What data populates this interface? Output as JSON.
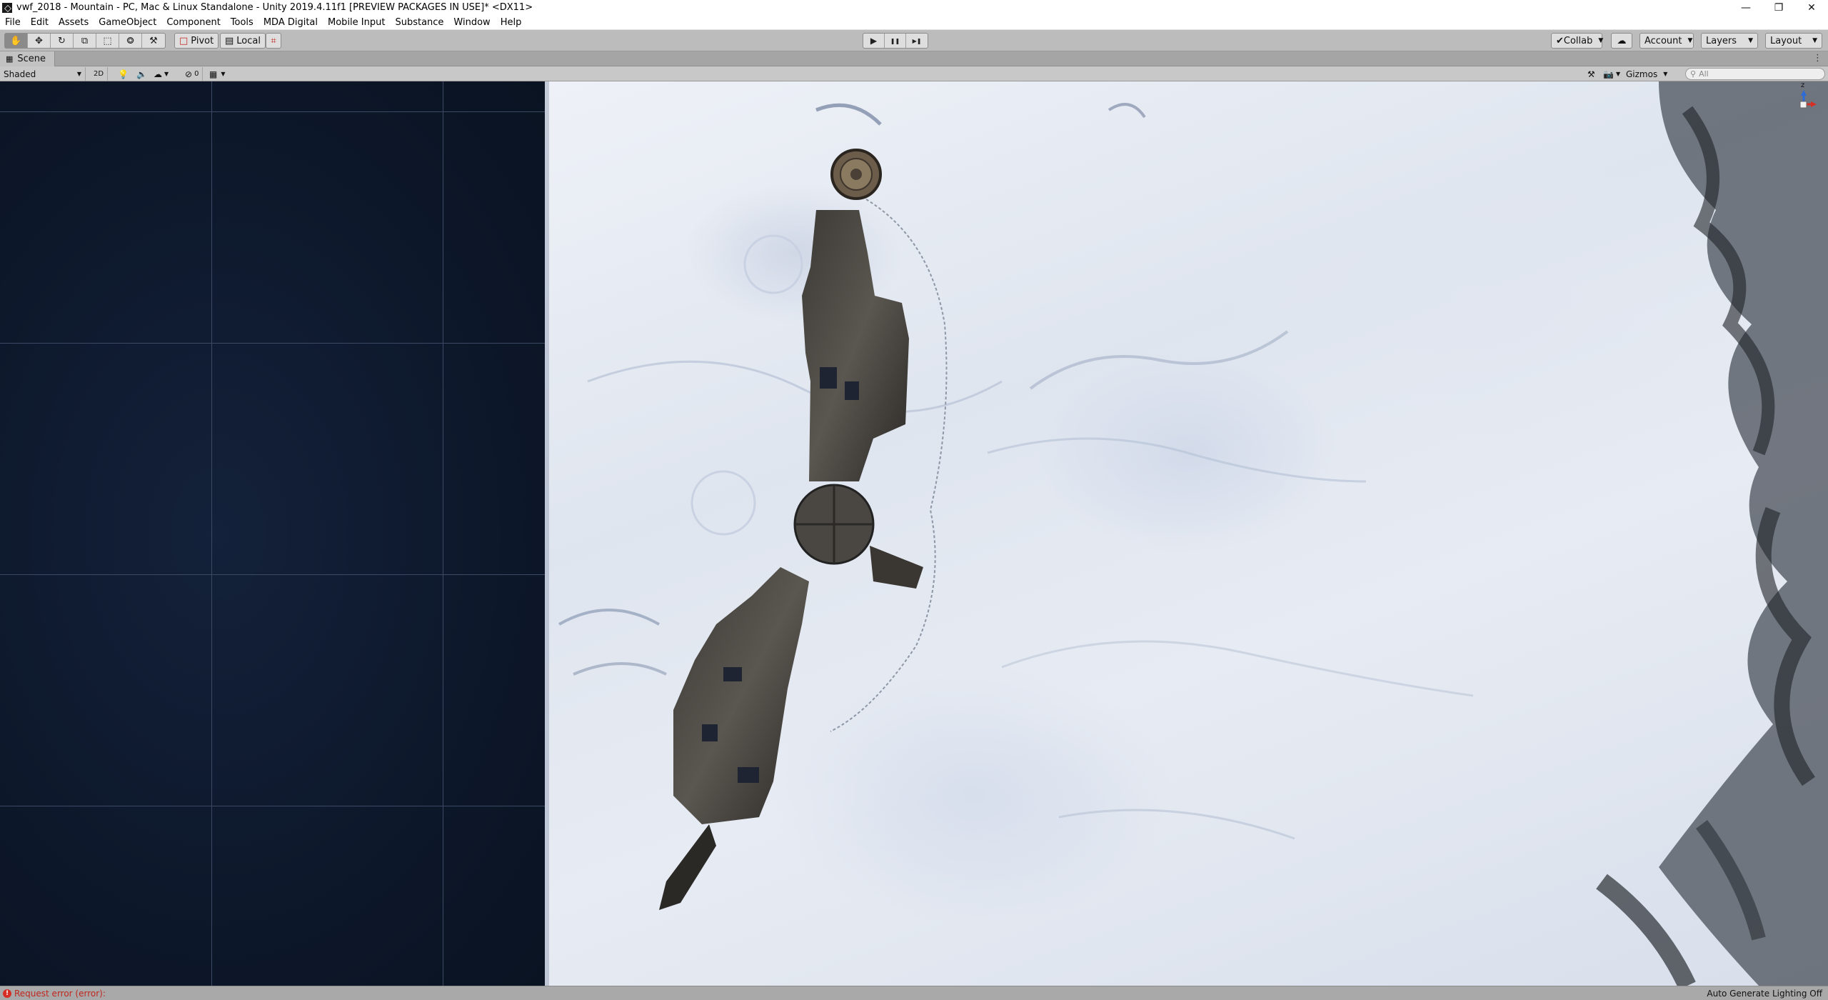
{
  "window": {
    "title": "vwf_2018 - Mountain - PC, Mac & Linux Standalone - Unity 2019.4.11f1 [PREVIEW PACKAGES IN USE]* <DX11>",
    "minimize_glyph": "—",
    "maximize_glyph": "❐",
    "close_glyph": "✕"
  },
  "menu": {
    "items": [
      "File",
      "Edit",
      "Assets",
      "GameObject",
      "Component",
      "Tools",
      "MDA Digital",
      "Mobile Input",
      "Substance",
      "Window",
      "Help"
    ]
  },
  "toolbar": {
    "tools": [
      {
        "icon": "hand-icon",
        "glyph": "✋"
      },
      {
        "icon": "move-icon",
        "glyph": "✥"
      },
      {
        "icon": "rotate-icon",
        "glyph": "↻"
      },
      {
        "icon": "scale-icon",
        "glyph": "⧉"
      },
      {
        "icon": "rect-icon",
        "glyph": "⬚"
      },
      {
        "icon": "transform-icon",
        "glyph": "⭗"
      },
      {
        "icon": "custom-tool-icon",
        "glyph": "⚒"
      }
    ],
    "pivot_label": "Pivot",
    "local_label": "Local",
    "grid_snap_glyph": "⌗",
    "play_glyph": "▶",
    "pause_glyph": "❚❚",
    "step_glyph": "▶❚",
    "collab_label": "Collab",
    "cloud_glyph": "☁",
    "account_label": "Account",
    "layers_label": "Layers",
    "layout_label": "Layout"
  },
  "scene_tab": {
    "label": "Scene",
    "menu_glyph": "⋮"
  },
  "scene_toolbar": {
    "draw_mode": "Shaded",
    "mode_2d": "2D",
    "hidden_count": "0",
    "gizmos_label": "Gizmos",
    "search_placeholder": "All"
  },
  "gizmo": {
    "axis_z": "z"
  },
  "status": {
    "error_text": "Request error (error):",
    "right_text": "Auto Generate Lighting Off"
  },
  "colors": {
    "accent_error": "#d62f25",
    "editor_bg": "#c2c2c2",
    "scene_bg": "#0e1a2c"
  }
}
